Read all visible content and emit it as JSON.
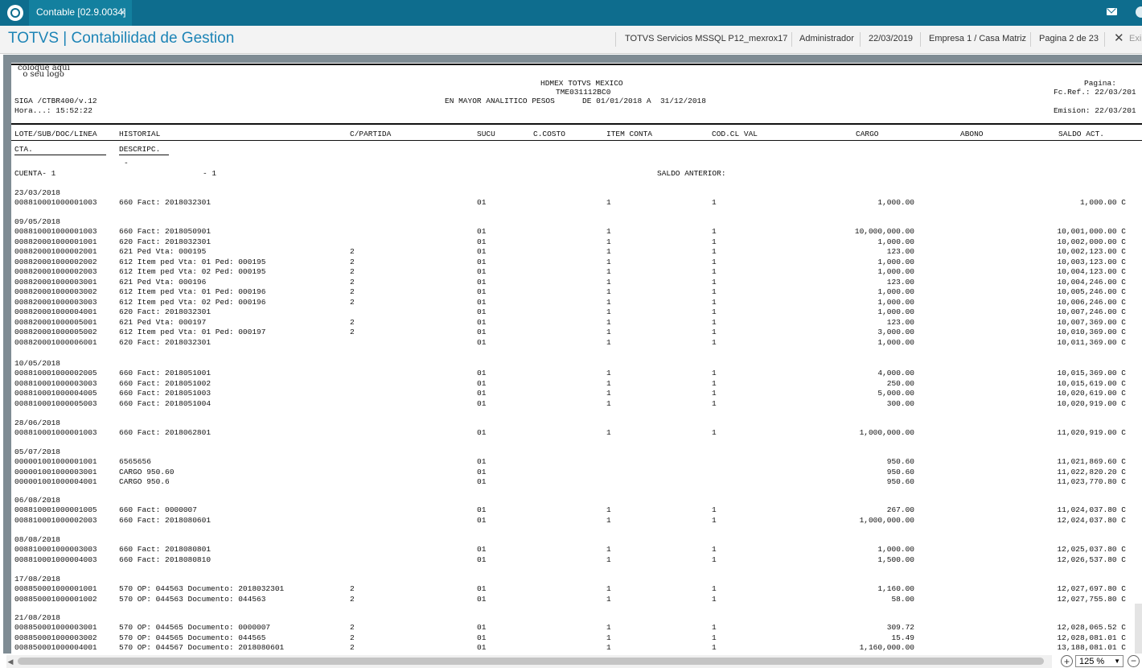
{
  "tab": {
    "label": "Contable [02.9.0034]",
    "close": "×"
  },
  "header": {
    "title": "TOTVS | Contabilidad de Gestion",
    "environment": "TOTVS Servicios MSSQL P12_mexrox17",
    "user": "Administrador",
    "date": "22/03/2019",
    "company": "Empresa 1 / Casa Matriz",
    "page": "Pagina 2 de 23",
    "exit_label": "Exi"
  },
  "report": {
    "logo": "coloque aqui\n  o seu logo",
    "company_name": "HDMEX TOTVS MEXICO",
    "report_code": "TME031112BC0",
    "siga": "SIGA /CTBR400/v.12",
    "hora": "Hora...: 15:52:22",
    "subtitle": "EN MAYOR ANALITICO PESOS      DE 01/01/2018 A  31/12/2018",
    "pagina": "Pagina:",
    "fc_ref": "Fc.Ref.: 22/03/201",
    "emision": "Emision: 22/03/201",
    "columns": {
      "lote": "LOTE/SUB/DOC/LINEA",
      "historial": "HISTORIAL",
      "cpartida": "C/PARTIDA",
      "sucu": "SUCU",
      "ccosto": "C.COSTO",
      "item": "ITEM CONTA",
      "codcl": "COD.CL VAL",
      "cargo": "CARGO",
      "abono": "ABONO",
      "saldo": "SALDO ACT."
    },
    "cta": "CTA.",
    "descripc": "DESCRIPC.",
    "dash": "-",
    "cuenta": "CUENTA- 1",
    "cuenta_desc": "- 1",
    "saldo_anterior": "SALDO ANTERIOR:",
    "groups": [
      {
        "date": "23/03/2018",
        "rows": [
          [
            "008810001000001003",
            "660 Fact: 2018032301",
            "",
            "01",
            "1",
            "1",
            "1,000.00",
            "1,000.00 C"
          ]
        ]
      },
      {
        "date": "09/05/2018",
        "rows": [
          [
            "008810001000001003",
            "660 Fact: 2018050901",
            "",
            "01",
            "1",
            "1",
            "10,000,000.00",
            "10,001,000.00 C"
          ],
          [
            "008820001000001001",
            "620 Fact: 2018032301",
            "",
            "01",
            "1",
            "1",
            "1,000.00",
            "10,002,000.00 C"
          ],
          [
            "008820001000002001",
            "621 Ped Vta: 000195",
            "2",
            "01",
            "1",
            "1",
            "123.00",
            "10,002,123.00 C"
          ],
          [
            "008820001000002002",
            "612 Item ped Vta: 01 Ped: 000195",
            "2",
            "01",
            "1",
            "1",
            "1,000.00",
            "10,003,123.00 C"
          ],
          [
            "008820001000002003",
            "612 Item ped Vta: 02 Ped: 000195",
            "2",
            "01",
            "1",
            "1",
            "1,000.00",
            "10,004,123.00 C"
          ],
          [
            "008820001000003001",
            "621 Ped Vta: 000196",
            "2",
            "01",
            "1",
            "1",
            "123.00",
            "10,004,246.00 C"
          ],
          [
            "008820001000003002",
            "612 Item ped Vta: 01 Ped: 000196",
            "2",
            "01",
            "1",
            "1",
            "1,000.00",
            "10,005,246.00 C"
          ],
          [
            "008820001000003003",
            "612 Item ped Vta: 02 Ped: 000196",
            "2",
            "01",
            "1",
            "1",
            "1,000.00",
            "10,006,246.00 C"
          ],
          [
            "008820001000004001",
            "620 Fact: 2018032301",
            "",
            "01",
            "1",
            "1",
            "1,000.00",
            "10,007,246.00 C"
          ],
          [
            "008820001000005001",
            "621 Ped Vta: 000197",
            "2",
            "01",
            "1",
            "1",
            "123.00",
            "10,007,369.00 C"
          ],
          [
            "008820001000005002",
            "612 Item ped Vta: 01 Ped: 000197",
            "2",
            "01",
            "1",
            "1",
            "3,000.00",
            "10,010,369.00 C"
          ],
          [
            "008820001000006001",
            "620 Fact: 2018032301",
            "",
            "01",
            "1",
            "1",
            "1,000.00",
            "10,011,369.00 C"
          ]
        ]
      },
      {
        "date": "10/05/2018",
        "rows": [
          [
            "008810001000002005",
            "660 Fact: 2018051001",
            "",
            "01",
            "1",
            "1",
            "4,000.00",
            "10,015,369.00 C"
          ],
          [
            "008810001000003003",
            "660 Fact: 2018051002",
            "",
            "01",
            "1",
            "1",
            "250.00",
            "10,015,619.00 C"
          ],
          [
            "008810001000004005",
            "660 Fact: 2018051003",
            "",
            "01",
            "1",
            "1",
            "5,000.00",
            "10,020,619.00 C"
          ],
          [
            "008810001000005003",
            "660 Fact: 2018051004",
            "",
            "01",
            "1",
            "1",
            "300.00",
            "10,020,919.00 C"
          ]
        ]
      },
      {
        "date": "28/06/2018",
        "rows": [
          [
            "008810001000001003",
            "660 Fact: 2018062801",
            "",
            "01",
            "1",
            "1",
            "1,000,000.00",
            "11,020,919.00 C"
          ]
        ]
      },
      {
        "date": "05/07/2018",
        "rows": [
          [
            "000001001000001001",
            "6565656",
            "",
            "01",
            "",
            "",
            "950.60",
            "11,021,869.60 C"
          ],
          [
            "000001001000003001",
            "CARGO 950.60",
            "",
            "01",
            "",
            "",
            "950.60",
            "11,022,820.20 C"
          ],
          [
            "000001001000004001",
            "CARGO 950.6",
            "",
            "01",
            "",
            "",
            "950.60",
            "11,023,770.80 C"
          ]
        ]
      },
      {
        "date": "06/08/2018",
        "rows": [
          [
            "008810001000001005",
            "660 Fact: 0000007",
            "",
            "01",
            "1",
            "1",
            "267.00",
            "11,024,037.80 C"
          ],
          [
            "008810001000002003",
            "660 Fact: 2018080601",
            "",
            "01",
            "1",
            "1",
            "1,000,000.00",
            "12,024,037.80 C"
          ]
        ]
      },
      {
        "date": "08/08/2018",
        "rows": [
          [
            "008810001000003003",
            "660 Fact: 2018080801",
            "",
            "01",
            "1",
            "1",
            "1,000.00",
            "12,025,037.80 C"
          ],
          [
            "008810001000004003",
            "660 Fact: 2018080810",
            "",
            "01",
            "1",
            "1",
            "1,500.00",
            "12,026,537.80 C"
          ]
        ]
      },
      {
        "date": "17/08/2018",
        "rows": [
          [
            "008850001000001001",
            "570 OP: 044563 Documento: 2018032301",
            "2",
            "01",
            "1",
            "1",
            "1,160.00",
            "12,027,697.80 C"
          ],
          [
            "008850001000001002",
            "570 OP: 044563 Documento: 044563",
            "2",
            "01",
            "1",
            "1",
            "58.00",
            "12,027,755.80 C"
          ]
        ]
      },
      {
        "date": "21/08/2018",
        "rows": [
          [
            "008850001000003001",
            "570 OP: 044565 Documento: 0000007",
            "2",
            "01",
            "1",
            "1",
            "309.72",
            "12,028,065.52 C"
          ],
          [
            "008850001000003002",
            "570 OP: 044565 Documento: 044565",
            "2",
            "01",
            "1",
            "1",
            "15.49",
            "12,028,081.01 C"
          ],
          [
            "008850001000004001",
            "570 OP: 044567 Documento: 2018080601",
            "2",
            "01",
            "1",
            "1",
            "1,160,000.00",
            "13,188,081.01 C"
          ]
        ]
      }
    ]
  },
  "zoom": {
    "value": "125 %",
    "zoom_in": "+",
    "zoom_out": "−",
    "arrow": "▼"
  }
}
